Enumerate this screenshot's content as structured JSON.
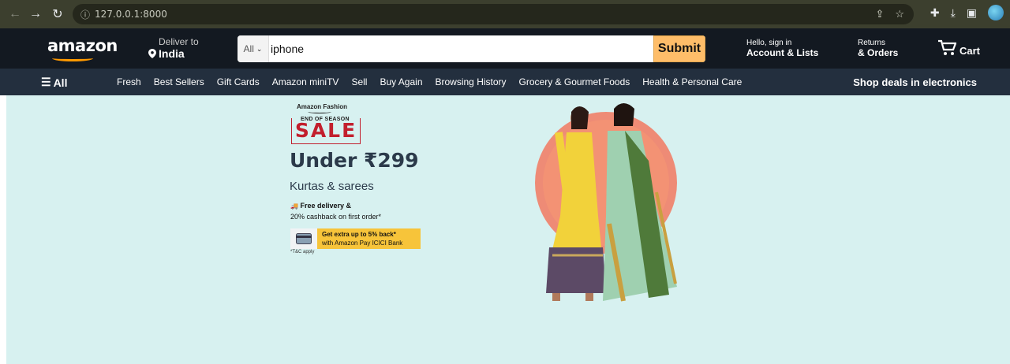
{
  "browser": {
    "url": "127.0.0.1:8000"
  },
  "header": {
    "logo": "amazon",
    "deliver_label": "Deliver to",
    "deliver_location": "India",
    "search_category": "All",
    "search_value": "iphone",
    "search_button": "Submit",
    "account_greeting": "Hello, sign in",
    "account_label": "Account & Lists",
    "returns_label": "Returns",
    "orders_label": "& Orders",
    "cart_label": "Cart"
  },
  "subnav": {
    "all_label": "All",
    "links": [
      "Fresh",
      "Best Sellers",
      "Gift Cards",
      "Amazon miniTV",
      "Sell",
      "Buy Again",
      "Browsing History",
      "Grocery & Gourmet Foods",
      "Health & Personal Care"
    ],
    "deals": "Shop deals in electronics"
  },
  "hero": {
    "brand": "Amazon Fashion",
    "tag": "END OF SEASON",
    "sale": "SALE",
    "price": "Under ₹299",
    "category": "Kurtas & sarees",
    "perk_line1": "Free delivery &",
    "perk_line2": "20% cashback on first order*",
    "bank_line1": "Get extra up to 5% back*",
    "bank_line2": "with Amazon Pay ICICI Bank",
    "tc": "*T&C apply",
    "bg_color": "#d7f1f0",
    "accent_color": "#c21f2d"
  }
}
